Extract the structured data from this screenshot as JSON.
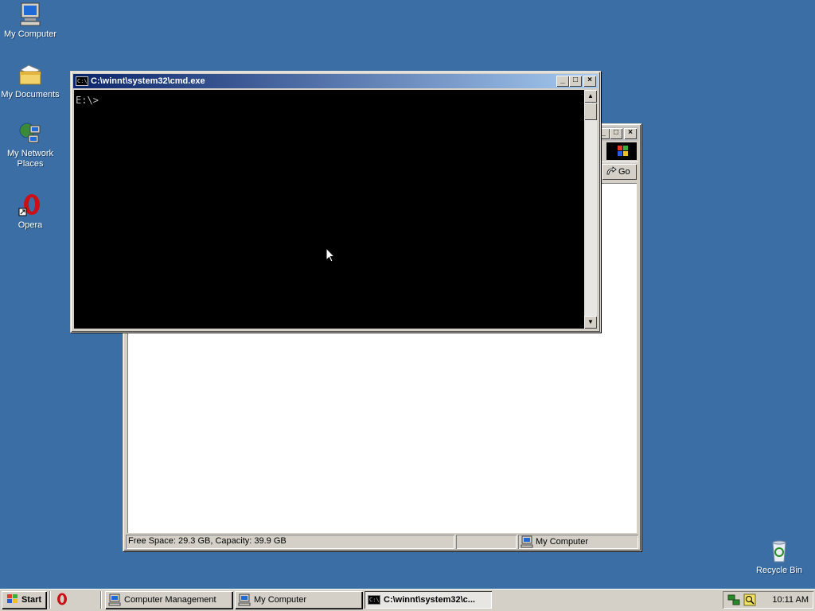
{
  "desktop": {
    "icons": [
      {
        "label": "My Computer",
        "icon": "computer-icon"
      },
      {
        "label": "My Documents",
        "icon": "folder-documents-icon"
      },
      {
        "label": "My Network Places",
        "icon": "network-icon"
      },
      {
        "label": "Opera",
        "icon": "opera-icon"
      },
      {
        "label": "Recycle Bin",
        "icon": "recycle-bin-icon"
      }
    ]
  },
  "cmd_window": {
    "title": "C:\\winnt\\system32\\cmd.exe",
    "prompt": "E:\\>",
    "buttons": {
      "minimize": "_",
      "maximize": "□",
      "close": "×"
    }
  },
  "mycomputer_window": {
    "go_label": "Go",
    "status": {
      "free_space": "Free Space: 29.3 GB, Capacity: 39.9 GB",
      "location": "My Computer"
    },
    "buttons": {
      "minimize": "_",
      "maximize": "□",
      "close": "×"
    }
  },
  "taskbar": {
    "start_label": "Start",
    "tasks": [
      {
        "label": "Computer Management",
        "icon": "computer-management-icon",
        "active": false
      },
      {
        "label": "My Computer",
        "icon": "computer-icon",
        "active": false
      },
      {
        "label": "C:\\winnt\\system32\\c...",
        "icon": "cmd-icon",
        "active": true
      }
    ],
    "clock": "10:11 AM"
  },
  "colors": {
    "desktop": "#3a6ea5",
    "title_active_start": "#0a246a",
    "title_active_end": "#a6caf0",
    "face": "#d4d0c8"
  }
}
